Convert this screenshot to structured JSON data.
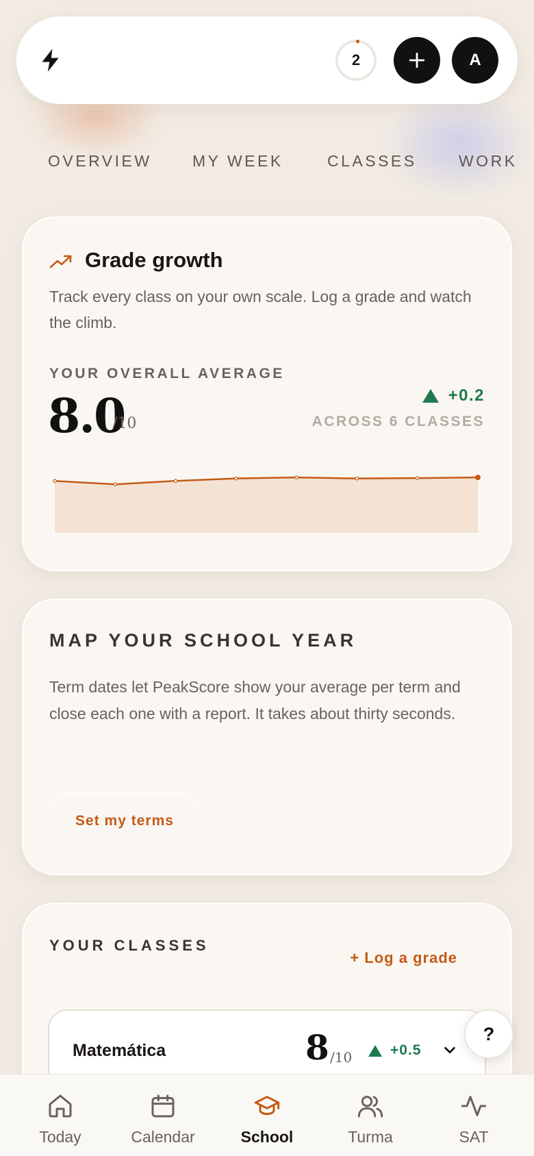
{
  "colors": {
    "accent": "#c45a16",
    "positive": "#1e7a4e",
    "background": "#f1ebe3",
    "card": "#faf7f3"
  },
  "header": {
    "logo_icon": "bolt-icon",
    "notification_count": "2",
    "add_icon": "plus-icon",
    "avatar_initial": "A"
  },
  "tabs": [
    {
      "label": "OVERVIEW"
    },
    {
      "label": "MY WEEK"
    },
    {
      "label": "CLASSES"
    },
    {
      "label": "WORK"
    }
  ],
  "grade_growth": {
    "icon": "trend-up-icon",
    "title": "Grade growth",
    "description": "Track every class on your own scale. Log a grade and watch the climb.",
    "overline": "YOUR OVERALL AVERAGE",
    "average": "8.0",
    "scale": "/10",
    "delta": "+0.2",
    "across": "ACROSS 6 CLASSES"
  },
  "chart_data": {
    "type": "area",
    "x": [
      1,
      2,
      3,
      4,
      5,
      6,
      7,
      8
    ],
    "values": [
      7.9,
      7.8,
      7.9,
      7.97,
      8.0,
      7.97,
      7.98,
      8.0
    ],
    "ylim": [
      6.4,
      8.3
    ],
    "grid": false,
    "title": "",
    "xlabel": "",
    "ylabel": ""
  },
  "school_year": {
    "title": "MAP YOUR SCHOOL YEAR",
    "description": "Term dates let PeakScore show your average per term and close each one with a report. It takes about thirty seconds.",
    "button_label": "Set my terms"
  },
  "classes": {
    "title": "YOUR CLASSES",
    "log_grade_label": "+ Log a grade",
    "items": [
      {
        "name": "Matemática",
        "grade": "8",
        "scale": "/10",
        "delta": "+0.5"
      }
    ]
  },
  "help": {
    "label": "?"
  },
  "bottom_nav": [
    {
      "label": "Today",
      "icon": "home-icon",
      "active": false
    },
    {
      "label": "Calendar",
      "icon": "calendar-icon",
      "active": false
    },
    {
      "label": "School",
      "icon": "graduation-cap-icon",
      "active": true
    },
    {
      "label": "Turma",
      "icon": "users-icon",
      "active": false
    },
    {
      "label": "SAT",
      "icon": "activity-icon",
      "active": false
    }
  ]
}
